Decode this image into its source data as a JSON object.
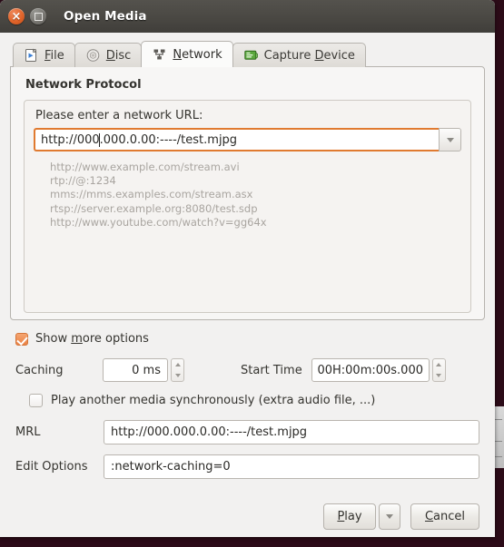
{
  "window": {
    "title": "Open Media",
    "close_icon": "close-icon",
    "maximize_icon": "maximize-icon"
  },
  "tabs": [
    {
      "label_before": "",
      "accel": "F",
      "label_after": "ile",
      "icon": "file-icon",
      "active": false
    },
    {
      "label_before": "",
      "accel": "D",
      "label_after": "isc",
      "icon": "disc-icon",
      "active": false
    },
    {
      "label_before": "",
      "accel": "N",
      "label_after": "etwork",
      "icon": "network-icon",
      "active": true
    },
    {
      "label_before": "Capture ",
      "accel": "D",
      "label_after": "evice",
      "icon": "capture-device-icon",
      "active": false
    }
  ],
  "network_panel": {
    "group_title": "Network Protocol",
    "url_label": "Please enter a network URL:",
    "url_value_before_caret": "http://000",
    "url_value_after_caret": ".000.0.00:----/test.mjpg",
    "url_value_full": "http://000.000.0.00:----/test.mjpg",
    "dropdown_icon": "chevron-down-icon",
    "examples": [
      "http://www.example.com/stream.avi",
      "rtp://@:1234",
      "mms://mms.examples.com/stream.asx",
      "rtsp://server.example.org:8080/test.sdp",
      "http://www.youtube.com/watch?v=gg64x"
    ]
  },
  "show_more": {
    "checked": true,
    "label_before": "Show ",
    "accel": "m",
    "label_after": "ore options"
  },
  "options": {
    "caching_label": "Caching",
    "caching_value": "0 ms",
    "start_time_label": "Start Time",
    "start_time_value": "00H:00m:00s.000",
    "sync_checked": false,
    "sync_label": "Play another media synchronously (extra audio file, ...)",
    "mrl_label": "MRL",
    "mrl_value": "http://000.000.0.00:----/test.mjpg",
    "edit_options_label": "Edit Options",
    "edit_options_value": ":network-caching=0"
  },
  "footer": {
    "play_accel": "P",
    "play_label_after": "lay",
    "play_menu_icon": "chevron-down-icon",
    "cancel_accel": "C",
    "cancel_label_after": "ancel"
  },
  "colors": {
    "accent_orange": "#e07a30",
    "titlebar": "#4c4a45",
    "dialog_bg": "#f2f1f0",
    "desktop_bg": "#2c0b18"
  }
}
